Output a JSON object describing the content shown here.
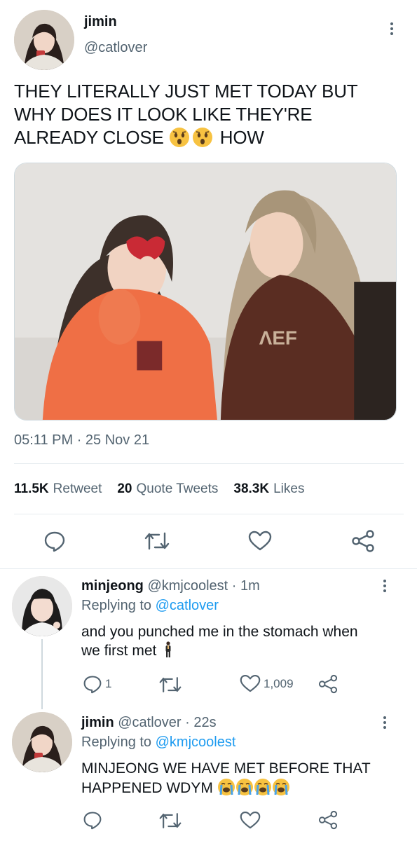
{
  "main_tweet": {
    "author_name": "jimin",
    "author_handle": "@catlover",
    "text_line1": "THEY LITERALLY JUST MET TODAY BUT",
    "text_line2": "WHY DOES IT LOOK LIKE THEY'RE",
    "text_line3_start": "ALREADY CLOSE",
    "text_line3_end": "HOW",
    "time": "05:11 PM",
    "date_sep": "·",
    "date": "25 Nov 21",
    "stats": {
      "retweets_count": "11.5K",
      "retweets_label": "Retweet",
      "quotes_count": "20",
      "quotes_label": "Quote Tweets",
      "likes_count": "38.3K",
      "likes_label": "Likes"
    }
  },
  "replies": [
    {
      "name": "minjeong",
      "handle": "@kmjcoolest",
      "sep": "·",
      "time": "1m",
      "replying_prefix": "Replying to",
      "replying_to": "@catlover",
      "text_line1": "and you punched me in the stomach when",
      "text_line2": "we first met",
      "retweets": "",
      "replies": "1",
      "likes": "1,009"
    },
    {
      "name": "jimin",
      "handle": "@catlover",
      "sep": "·",
      "time": "22s",
      "replying_prefix": "Replying to",
      "replying_to": "@kmjcoolest",
      "text_line1": "MINJEONG WE HAVE MET BEFORE THAT",
      "text_line2": "HAPPENED WDYM"
    }
  ],
  "icons": {
    "more": "more-vertical-icon",
    "reply": "reply-bubble-icon",
    "retweet": "retweet-icon",
    "like": "heart-icon",
    "share": "share-icon",
    "emoji_astonished": "astonished-face-emoji",
    "emoji_crying": "loudly-crying-face-emoji",
    "emoji_person": "person-standing-emoji"
  },
  "colors": {
    "link": "#1d9bf0",
    "secondary_text": "#536471",
    "primary_text": "#0f1419",
    "divider": "#e6ecf0"
  }
}
